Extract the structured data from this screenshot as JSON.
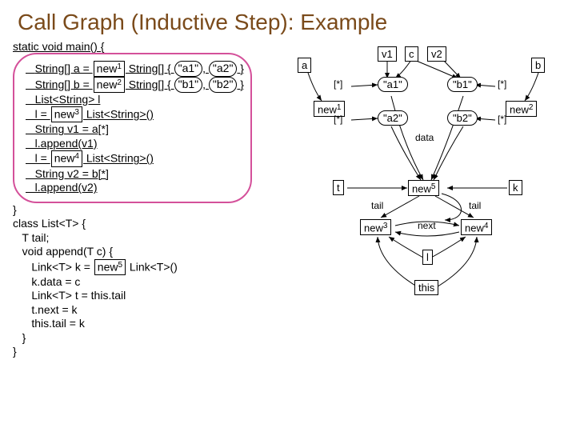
{
  "title": "Call Graph (Inductive Step): Example",
  "code": {
    "l0": "static void main() {",
    "arrA_pre": "   String[] a = ",
    "arrA_new": "new",
    "arrA_sup": "1",
    "arrA_mid": " String[] { ",
    "arrA_s1": "\"a1\"",
    "arrA_sep": ", ",
    "arrA_s2": "\"a2\"",
    "arrA_end": " }",
    "arrB_pre": "   String[] b = ",
    "arrB_new": "new",
    "arrB_sup": "2",
    "arrB_mid": " String[] { ",
    "arrB_s1": "\"b1\"",
    "arrB_sep": ", ",
    "arrB_s2": "\"b2\"",
    "arrB_end": " }",
    "list_decl": "   List<String> l",
    "l3a": "   l = ",
    "l3_new": "new",
    "l3_sup": "3",
    "l3b": " List<String>()",
    "v1": "   String v1 = a[*]",
    "ap1": "   l.append(v1)",
    "l4a": "   l = ",
    "l4_new": "new",
    "l4_sup": "4",
    "l4b": " List<String>()",
    "v2": "   String v2 = b[*]",
    "ap2": "   l.append(v2)",
    "cb1": "}",
    "cls": "class List<T> {",
    "tail": "   T tail;",
    "appdecl": "   void append(T c) {",
    "link_a": "      Link<T> k = ",
    "link_new": "new",
    "link_sup": "5",
    "link_b": " Link<T>()",
    "kdata": "      k.data = c",
    "tthis": "      Link<T> t = this.tail",
    "tnext": "      t.next = k",
    "tailk": "      this.tail = k",
    "cb2": "   }",
    "cb3": "}"
  },
  "nodes": {
    "v1": "v1",
    "c": "c",
    "v2": "v2",
    "a": "a",
    "b": "b",
    "star1": "[*]",
    "star2": "[*]",
    "star3": "[*]",
    "star4": "[*]",
    "new1": "new",
    "new1s": "1",
    "new2": "new",
    "new2s": "2",
    "a1": "\"a1\"",
    "a2": "\"a2\"",
    "b1": "\"b1\"",
    "b2": "\"b2\"",
    "t": "t",
    "k": "k",
    "new5": "new",
    "new5s": "5",
    "new3": "new",
    "new3s": "3",
    "new4": "new",
    "new4s": "4"
  },
  "labels": {
    "data": "data",
    "tail1": "tail",
    "tail2": "tail",
    "next": "next",
    "l": "l",
    "this": "this"
  }
}
